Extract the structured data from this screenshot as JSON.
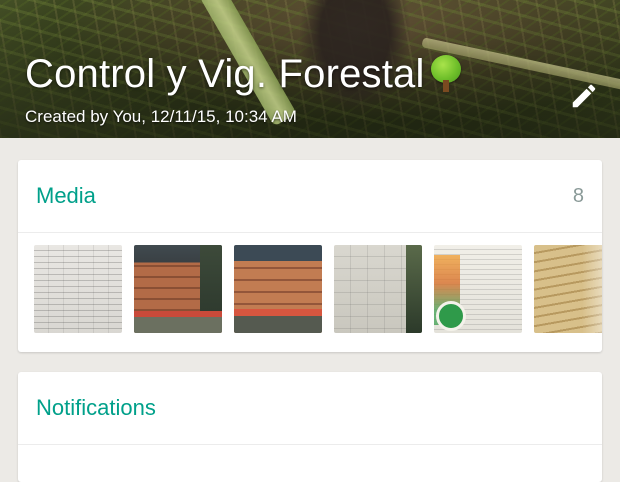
{
  "header": {
    "title": "Control y Vig. Forestal",
    "title_emoji": "tree-icon",
    "subtitle": "Created by You, 12/11/15, 10:34 AM",
    "edit_icon": "pencil-icon"
  },
  "media": {
    "title": "Media",
    "count": "8",
    "thumbnails": [
      {
        "name": "document-photo"
      },
      {
        "name": "truck-with-lumber-photo"
      },
      {
        "name": "truck-with-lumber-photo"
      },
      {
        "name": "form-document-photo"
      },
      {
        "name": "poster-document-photo"
      },
      {
        "name": "wood-planks-photo"
      }
    ]
  },
  "notifications": {
    "title": "Notifications"
  },
  "colors": {
    "accent": "#00a08a",
    "background": "#eceae6",
    "card": "#ffffff",
    "count_text": "#8a9a98"
  }
}
